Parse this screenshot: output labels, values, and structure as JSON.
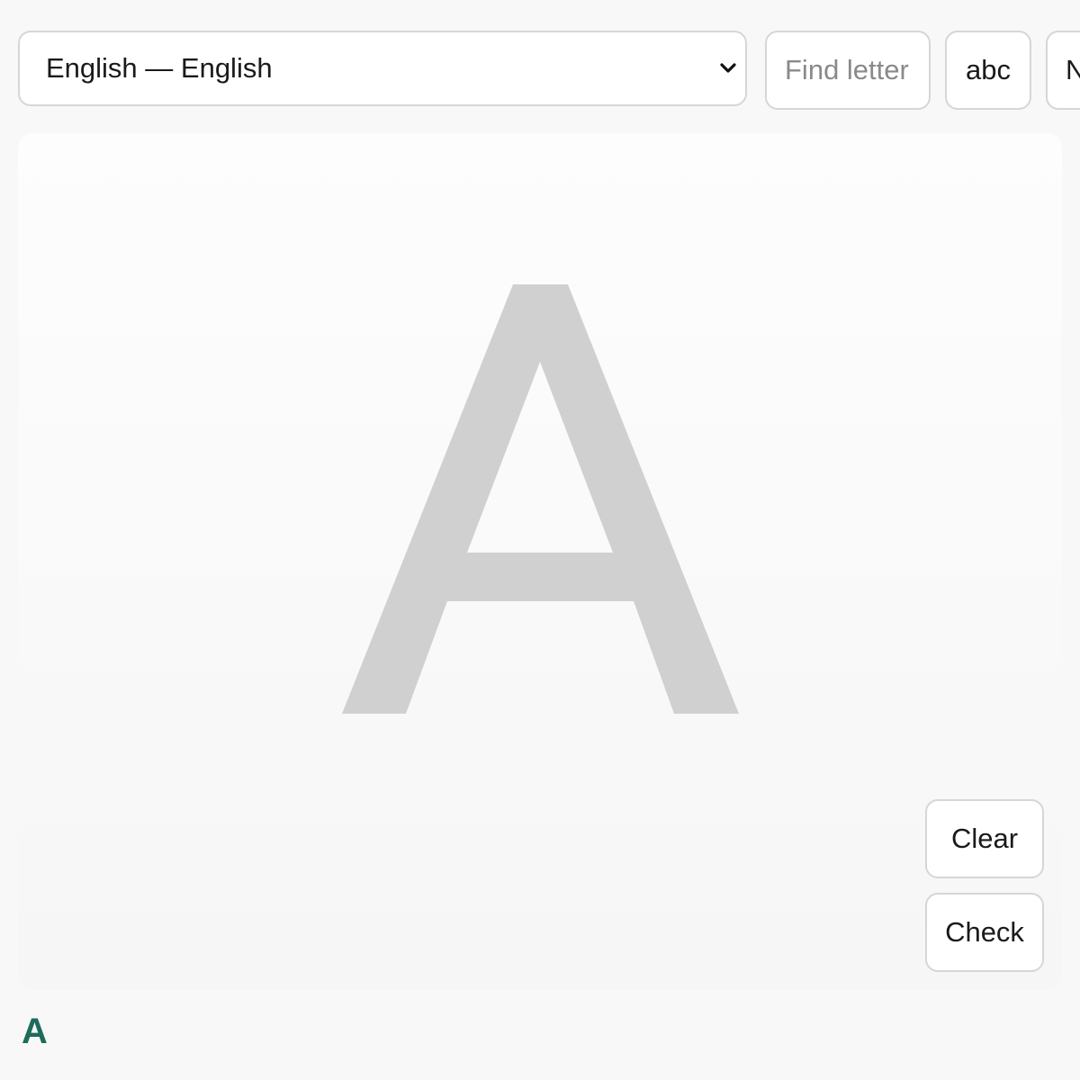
{
  "toolbar": {
    "language_select": {
      "selected": "English — English",
      "icon": "chevron-down-icon"
    },
    "find_input": {
      "placeholder": "Find letter",
      "value": ""
    },
    "case_toggle_label": "abc",
    "next_button_label": "N"
  },
  "canvas": {
    "guide_letter": "A",
    "guide_color": "#d0d0d0"
  },
  "actions": {
    "clear_label": "Clear",
    "check_label": "Check"
  },
  "result": {
    "letter": "A",
    "color": "#1e6b5a"
  }
}
